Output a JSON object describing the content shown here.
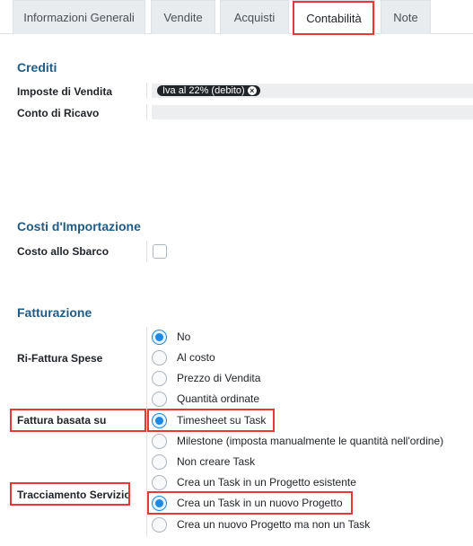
{
  "tabs": [
    {
      "label": "Informazioni Generali",
      "active": false
    },
    {
      "label": "Vendite",
      "active": false
    },
    {
      "label": "Acquisti",
      "active": false
    },
    {
      "label": "Contabilità",
      "active": true
    },
    {
      "label": "Note",
      "active": false
    }
  ],
  "crediti": {
    "title": "Crediti",
    "imposte_label": "Imposte di Vendita",
    "imposte_tag": "Iva al 22% (debito)",
    "conto_label": "Conto di Ricavo",
    "conto_value": ""
  },
  "costi": {
    "title": "Costi d'Importazione",
    "costo_label": "Costo allo Sbarco",
    "costo_checked": false
  },
  "fatturazione": {
    "title": "Fatturazione",
    "rifattura_label": "Ri-Fattura Spese",
    "fattura_label": "Fattura basata su",
    "tracciamento_label": "Tracciamento Servizio",
    "options": [
      {
        "label": "No",
        "checked": true
      },
      {
        "label": "Al costo",
        "checked": false
      },
      {
        "label": "Prezzo di Vendita",
        "checked": false
      },
      {
        "label": "Quantità ordinate",
        "checked": false
      },
      {
        "label": "Timesheet su Task",
        "checked": true
      },
      {
        "label": "Milestone (imposta manualmente le quantità nell'ordine)",
        "checked": false
      },
      {
        "label": "Non creare Task",
        "checked": false
      },
      {
        "label": "Crea un Task in un Progetto esistente",
        "checked": false
      },
      {
        "label": "Crea un Task in un nuovo Progetto",
        "checked": true
      },
      {
        "label": "Crea un nuovo Progetto ma non un Task",
        "checked": false
      }
    ]
  },
  "colors": {
    "accent": "#1e88e5",
    "section_title": "#1f5b87",
    "highlight": "#e53935"
  }
}
